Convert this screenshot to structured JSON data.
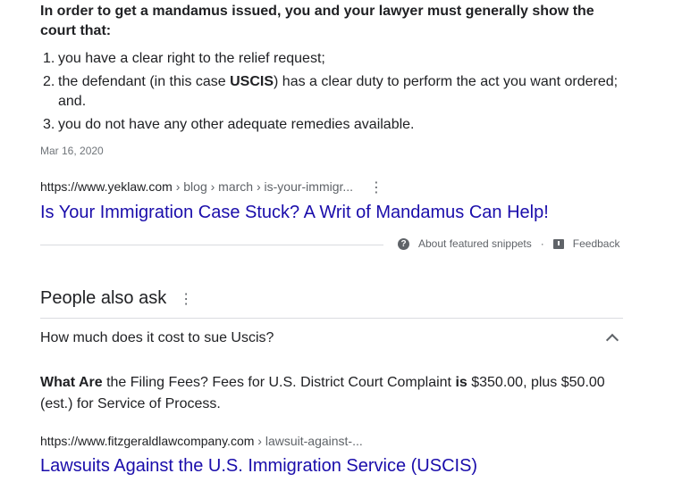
{
  "snippet": {
    "lead": "In order to get a mandamus issued, you and your lawyer must generally show the court that:",
    "items": [
      {
        "num": "1.",
        "text": "you have a clear right to the relief request;"
      },
      {
        "num": "2.",
        "pre": "the defendant (in this case ",
        "bold": "USCIS",
        "post": ") has a clear duty to perform the act you want ordered; and."
      },
      {
        "num": "3.",
        "text": "you do not have any other adequate remedies available."
      }
    ],
    "date": "Mar 16, 2020",
    "cite_domain": "https://www.yeklaw.com",
    "cite_path": " › blog › march › is-your-immigr...",
    "title": "Is Your Immigration Case Stuck? A Writ of Mandamus Can Help!",
    "about_label": "About featured snippets",
    "bullet": "·",
    "feedback_label": "Feedback",
    "more_icon": "vertical-dots-icon"
  },
  "paa": {
    "heading": "People also ask",
    "question": "How much does it cost to sue Uscis?",
    "answer": {
      "b1": "What Are",
      "t1": " the Filing Fees? Fees for U.S. District Court Complaint ",
      "b2": "is",
      "t2": " $350.00, plus $50.00 (est.) for Service of Process."
    },
    "cite_domain": "https://www.fitzgeraldlawcompany.com",
    "cite_path": " › lawsuit-against-...",
    "title": "Lawsuits Against the U.S. Immigration Service (USCIS)"
  },
  "colors": {
    "link": "#1a0dab",
    "text": "#202124",
    "muted": "#70757a",
    "divider": "#dadce0"
  }
}
